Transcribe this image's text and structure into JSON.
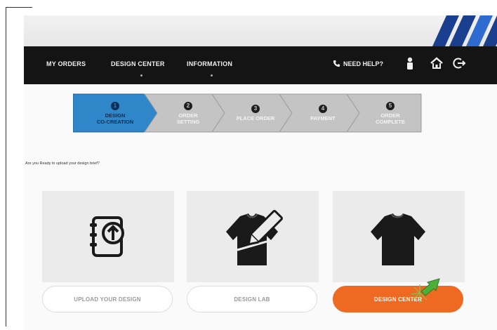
{
  "nav": {
    "items": [
      {
        "label": "MY ORDERS"
      },
      {
        "label": "DESIGN CENTER"
      },
      {
        "label": "INFORMATION"
      }
    ],
    "help_label": "NEED HELP?",
    "icons": [
      "phone-icon",
      "user-icon",
      "home-icon",
      "logout-icon"
    ]
  },
  "steps": [
    {
      "num": "1",
      "line1": "DESIGN",
      "line2": "CO-CREATION",
      "active": true
    },
    {
      "num": "2",
      "line1": "ORDER",
      "line2": "SETTING",
      "active": false
    },
    {
      "num": "3",
      "line1": "PLACE ORDER",
      "line2": "",
      "active": false
    },
    {
      "num": "4",
      "line1": "PAYMENT",
      "line2": "",
      "active": false
    },
    {
      "num": "5",
      "line1": "ORDER",
      "line2": "COMPLETE",
      "active": false
    }
  ],
  "question": "Are you Ready to upload your design brief?",
  "options": [
    {
      "icon": "upload-document-icon",
      "button": "UPLOAD YOUR DESIGN"
    },
    {
      "icon": "jersey-pencil-icon",
      "button": "DESIGN LAB"
    },
    {
      "icon": "jersey-icon",
      "button": "DESIGN CENTER"
    }
  ],
  "colors": {
    "accent": "#ee6a22",
    "active_step": "#2f86c8",
    "inactive_step": "#bdbdbd",
    "navbar": "#141414",
    "pointer": "#4caf3a"
  }
}
